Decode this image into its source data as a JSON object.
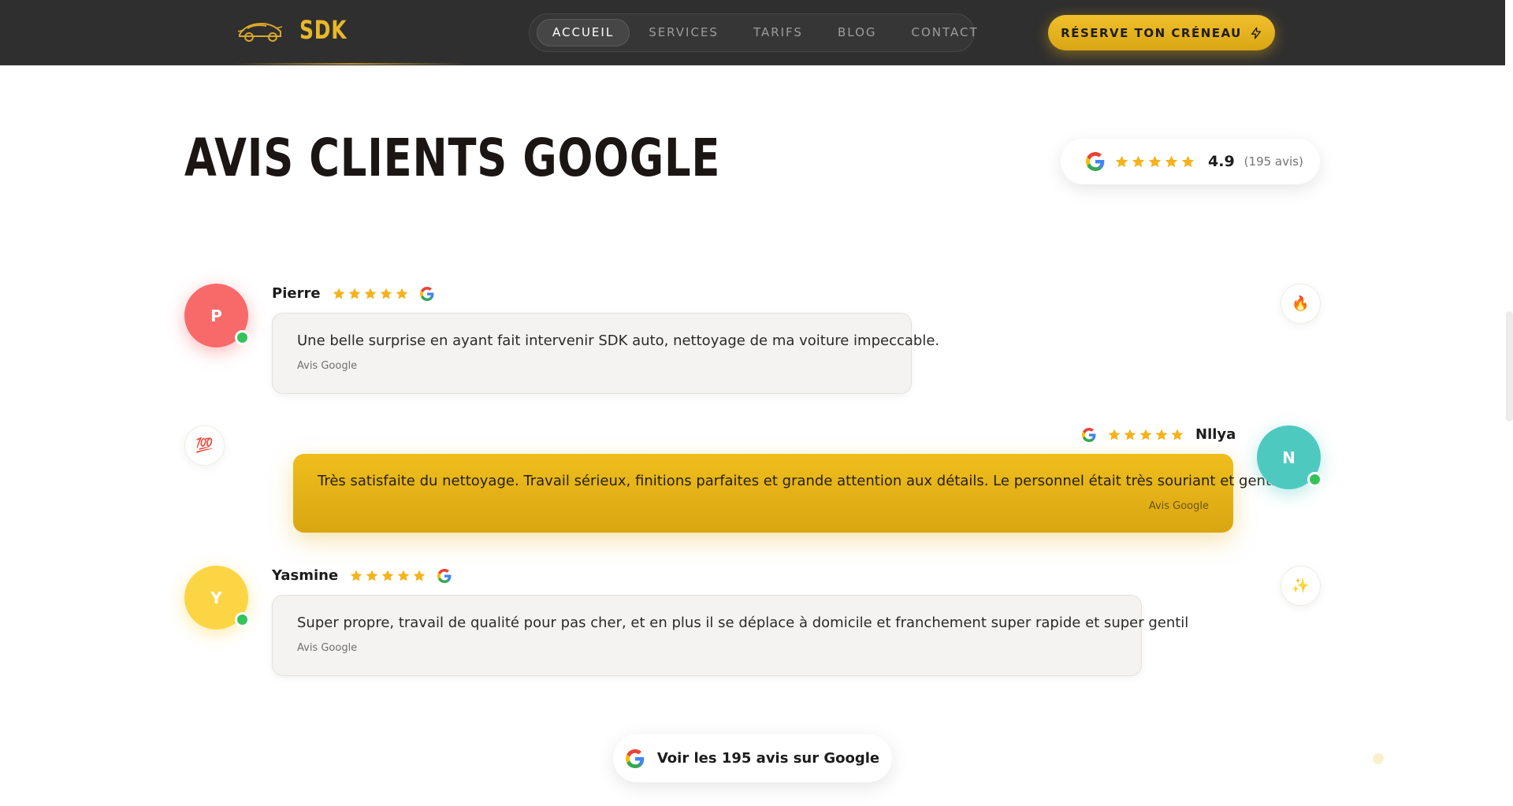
{
  "brand": {
    "name": "SDK",
    "logo_icon": "sports-car-icon",
    "accent": "#E8B72A"
  },
  "nav": {
    "items": [
      {
        "label": "ACCUEIL",
        "active": true
      },
      {
        "label": "SERVICES",
        "active": false
      },
      {
        "label": "TARIFS",
        "active": false
      },
      {
        "label": "BLOG",
        "active": false
      },
      {
        "label": "CONTACT",
        "active": false
      }
    ],
    "cta": {
      "label": "RÉSERVE TON CRÉNEAU",
      "icon": "lightning-icon"
    }
  },
  "section": {
    "title": "AVIS CLIENTS GOOGLE",
    "rating": {
      "stars": 5,
      "score": "4.9",
      "count": "(195 avis)"
    }
  },
  "reviews": [
    {
      "initial": "P",
      "name": "Pierre",
      "stars": 5,
      "avatar_color": "#F86A6A",
      "text": "Une belle surprise en ayant fait intervenir SDK auto, nettoyage de ma voiture impeccable.",
      "source": "Avis Google",
      "deco_icon": "🔥"
    },
    {
      "initial": "N",
      "name": "Nllya",
      "stars": 5,
      "avatar_color": "#4EC9C0",
      "text": "Très satisfaite du nettoyage. Travail sérieux, finitions parfaites et grande attention aux détails. Le personnel était très souriant et gentil.",
      "source": "Avis Google",
      "deco_icon": "💯"
    },
    {
      "initial": "Y",
      "name": "Yasmine",
      "stars": 5,
      "avatar_color": "#FCD545",
      "text": "Super propre, travail de qualité pour pas cher, et en plus il se déplace à domicile et franchement super rapide et super gentil",
      "source": "Avis Google",
      "deco_icon": "✨"
    }
  ],
  "footer_button": {
    "label": "Voir les 195 avis sur Google",
    "icon": "google-icon"
  }
}
